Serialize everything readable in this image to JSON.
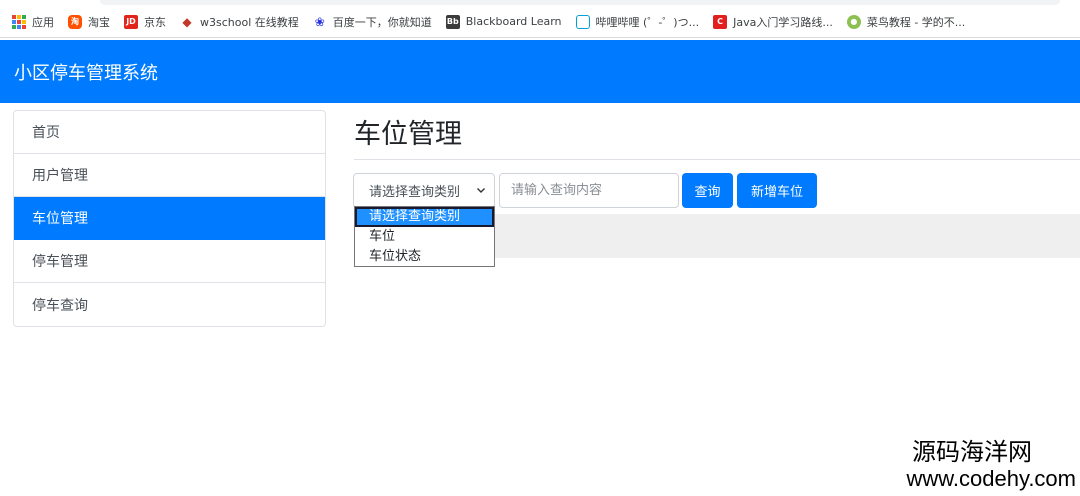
{
  "bookmarks": [
    {
      "label": "应用",
      "icon": "apps-grid-icon"
    },
    {
      "label": "淘宝",
      "icon": "taobao-icon"
    },
    {
      "label": "京东",
      "icon": "jd-icon"
    },
    {
      "label": "w3school 在线教程",
      "icon": "w3school-icon"
    },
    {
      "label": "百度一下，你就知道",
      "icon": "baidu-paw-icon"
    },
    {
      "label": "Blackboard Learn",
      "icon": "blackboard-icon"
    },
    {
      "label": "哔哩哔哩 (゜-゜)つ...",
      "icon": "bilibili-icon"
    },
    {
      "label": "Java入门学习路线...",
      "icon": "java-c-icon"
    },
    {
      "label": "菜鸟教程 - 学的不...",
      "icon": "runoob-icon"
    }
  ],
  "navbar": {
    "brand": "小区停车管理系统"
  },
  "sidebar": {
    "items": [
      {
        "label": "首页",
        "active": false
      },
      {
        "label": "用户管理",
        "active": false
      },
      {
        "label": "车位管理",
        "active": true
      },
      {
        "label": "停车管理",
        "active": false
      },
      {
        "label": "停车查询",
        "active": false
      }
    ]
  },
  "main": {
    "title": "车位管理",
    "search": {
      "select_value": "请选择查询类别",
      "options": [
        "请选择查询类别",
        "车位",
        "车位状态"
      ],
      "input_placeholder": "请输入查询内容",
      "query_label": "查询",
      "add_label": "新增车位"
    }
  },
  "watermark": {
    "name": "源码海洋网",
    "url": "www.codehy.com"
  },
  "colors": {
    "primary": "#007bff",
    "option_highlight": "#1e90ff"
  }
}
